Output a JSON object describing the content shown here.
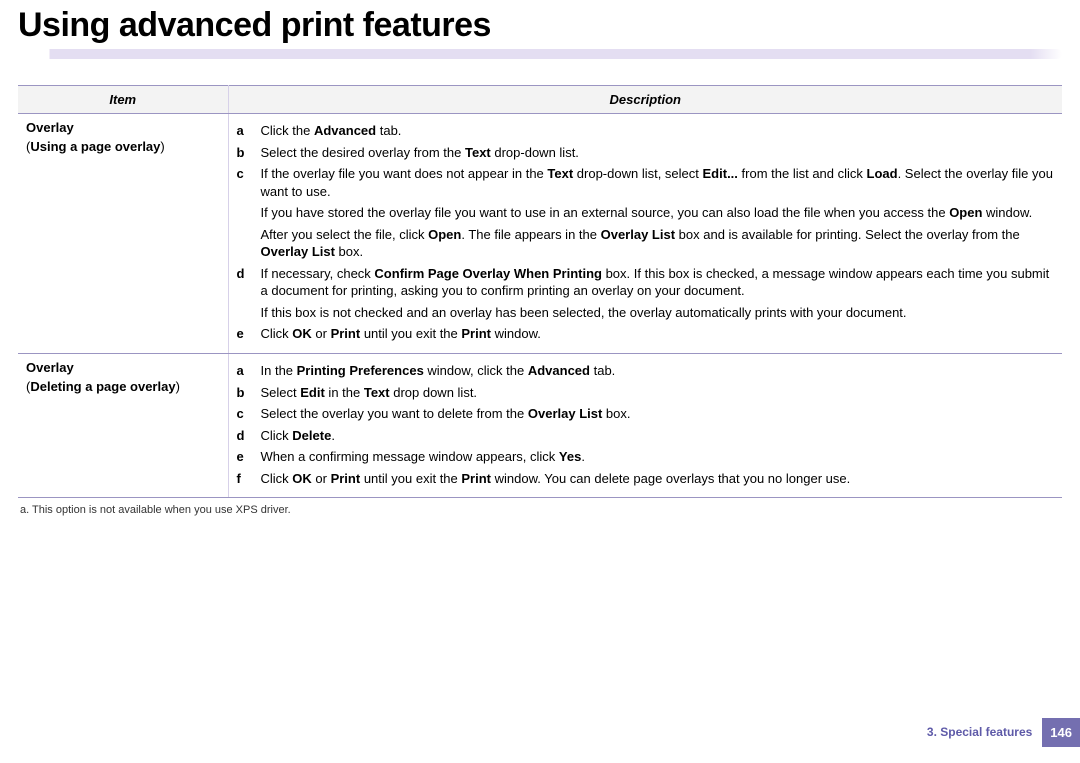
{
  "page": {
    "title": "Using advanced print features"
  },
  "table": {
    "header": {
      "item": "Item",
      "description": "Description"
    },
    "rows": [
      {
        "item": {
          "title": "Overlay",
          "sub_pre": "(",
          "sub_bold": "Using a page overlay",
          "sub_post": ")"
        },
        "steps": [
          {
            "letter": "a",
            "html": "Click the <b>Advanced</b> tab."
          },
          {
            "letter": "b",
            "html": "Select the desired overlay from the <b>Text</b> drop-down list."
          },
          {
            "letter": "c",
            "html": "If the overlay file you want does not appear in the <b>Text</b> drop-down list, select <b>Edit...</b> from the list and click <b>Load</b>. Select the overlay file you want to use."
          },
          {
            "letter": "",
            "html": "If you have stored the overlay file you want to use in an external source, you can also load the file when you access the <b>Open</b> window."
          },
          {
            "letter": "",
            "html": "After you select the file, click <b>Open</b>. The file appears in the <b>Overlay List</b> box and is available for printing. Select the overlay from the <b>Overlay List</b> box."
          },
          {
            "letter": "d",
            "html": "If necessary, check <b>Confirm Page Overlay When Printing</b> box. If this box is checked, a message window appears each time you submit a document for printing, asking you to confirm printing an overlay on your document."
          },
          {
            "letter": "",
            "html": "If this box is not checked and an overlay has been selected, the overlay automatically prints with your document."
          },
          {
            "letter": "e",
            "html": "Click <b>OK</b> or <b>Print</b> until you exit the <b>Print</b> window."
          }
        ]
      },
      {
        "item": {
          "title": "Overlay",
          "sub_pre": "(",
          "sub_bold": "Deleting a page overlay",
          "sub_post": ")"
        },
        "steps": [
          {
            "letter": "a",
            "html": "In the <b>Printing Preferences</b> window, click the <b>Advanced</b> tab."
          },
          {
            "letter": "b",
            "html": "Select <b>Edit</b> in the <b>Text</b> drop down list."
          },
          {
            "letter": "c",
            "html": "Select the overlay you want to delete from the <b>Overlay List</b> box."
          },
          {
            "letter": "d",
            "html": "Click <b>Delete</b>."
          },
          {
            "letter": "e",
            "html": "When a confirming message window appears, click <b>Yes</b>."
          },
          {
            "letter": "f",
            "html": "Click <b>OK</b> or <b>Print</b> until you exit the <b>Print</b> window. You can delete page overlays that you no longer use."
          }
        ]
      }
    ]
  },
  "footnote": "a.  This option is not available when you use XPS driver.",
  "footer": {
    "chapter": "3.  Special features",
    "page": "146"
  }
}
